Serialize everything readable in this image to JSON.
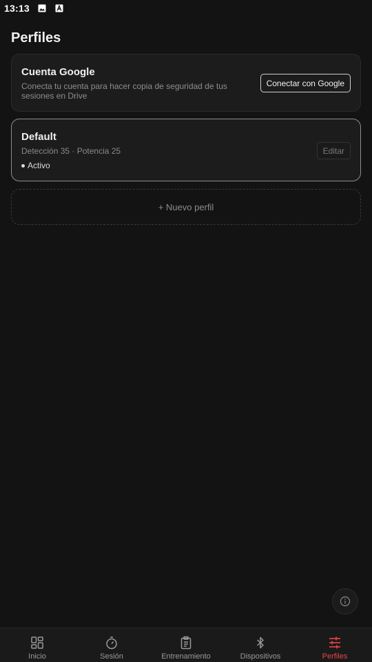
{
  "status_bar": {
    "time": "13:13",
    "icons": [
      "image-icon",
      "text-a-icon"
    ]
  },
  "page": {
    "title": "Perfiles"
  },
  "google_card": {
    "title": "Cuenta Google",
    "description": "Conecta tu cuenta para hacer copia de seguridad de tus sesiones en Drive",
    "connect_button": "Conectar con Google"
  },
  "profiles": [
    {
      "name": "Default",
      "meta": "Detección 35 · Potencia 25",
      "status": "Activo",
      "edit_label": "Editar"
    }
  ],
  "new_profile": {
    "label": "+ Nuevo perfil"
  },
  "info_button": {
    "icon": "info-icon"
  },
  "bottom_nav": {
    "items": [
      {
        "label": "Inicio",
        "icon": "grid-icon",
        "active": false
      },
      {
        "label": "Sesión",
        "icon": "stopwatch-icon",
        "active": false
      },
      {
        "label": "Entrenamiento",
        "icon": "clipboard-icon",
        "active": false
      },
      {
        "label": "Dispositivos",
        "icon": "bluetooth-icon",
        "active": false
      },
      {
        "label": "Perfiles",
        "icon": "sliders-icon",
        "active": true
      }
    ]
  },
  "colors": {
    "background": "#131313",
    "card": "#1c1c1c",
    "accent_active": "#ef4444",
    "text_muted": "#8e8e8e"
  }
}
